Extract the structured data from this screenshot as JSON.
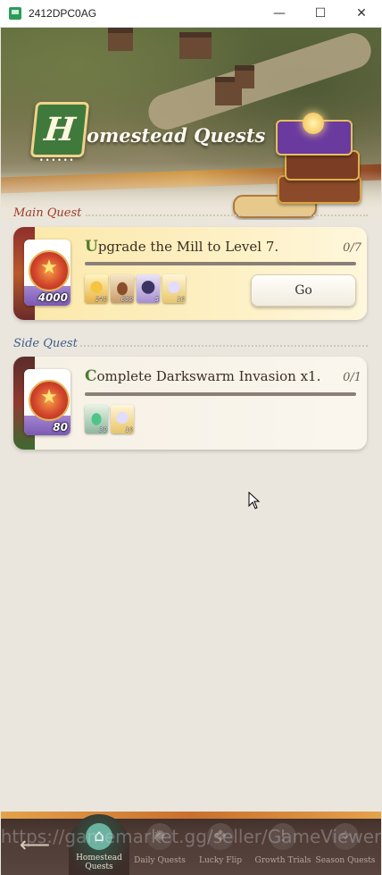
{
  "window": {
    "title": "2412DPC0AG",
    "controls": {
      "minimize": "—",
      "maximize": "☐",
      "close": "✕"
    }
  },
  "header": {
    "logo_letter": "H",
    "title": "omestead Quests"
  },
  "main_quest": {
    "section_label": "Main Quest",
    "reward_amount": "4000",
    "title_initial": "U",
    "title_rest": "pgrade the Mill to Level 7.",
    "progress": "0/7",
    "items": [
      {
        "icon": "golden-heart-icon",
        "qty": "240"
      },
      {
        "icon": "wood-log-icon",
        "qty": "600"
      },
      {
        "icon": "dark-ore-icon",
        "qty": "5"
      },
      {
        "icon": "diamond-icon",
        "qty": "10"
      }
    ],
    "go_label": "Go"
  },
  "side_quest": {
    "section_label": "Side Quest",
    "reward_amount": "80",
    "title_initial": "C",
    "title_rest": "omplete Darkswarm Invasion x1.",
    "progress": "0/1",
    "items": [
      {
        "icon": "green-flame-icon",
        "qty": "30"
      },
      {
        "icon": "diamond-icon",
        "qty": "10"
      }
    ]
  },
  "bottom_nav": {
    "back_icon": "back-arrow-icon",
    "tabs": [
      {
        "label": "Homestead Quests",
        "icon": "house-icon",
        "active": true
      },
      {
        "label": "Daily Quests",
        "icon": "sun-icon",
        "active": false
      },
      {
        "label": "Lucky Flip",
        "icon": "cards-icon",
        "active": false
      },
      {
        "label": "Growth Trials",
        "icon": "alert-scroll-icon",
        "active": false
      },
      {
        "label": "Season Quests",
        "icon": "compass-icon",
        "active": false
      }
    ]
  },
  "watermark": "https://gamemarket.gg/seller/GameViewer",
  "colors": {
    "main_title_initial": "#4f7a34",
    "main_quest_label": "#9b3a2a",
    "side_quest_label": "#3d5d8a",
    "card_main_bg": "#fbe8a9",
    "nav_bg": "#4f3a33"
  }
}
